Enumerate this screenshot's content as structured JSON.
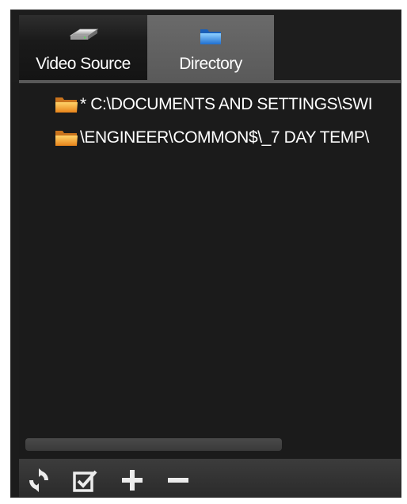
{
  "tabs": [
    {
      "label": "Video Source",
      "icon": "drive-icon",
      "selected": false
    },
    {
      "label": "Directory",
      "icon": "folder-icon",
      "selected": true
    }
  ],
  "tree": {
    "items": [
      {
        "label": "* C:\\DOCUMENTS AND SETTINGS\\SWI",
        "icon": "folder-icon"
      },
      {
        "label": "\\ENGINEER\\COMMON$\\_7 DAY TEMP\\",
        "icon": "folder-icon"
      }
    ]
  },
  "toolbar": {
    "buttons": [
      {
        "name": "refresh",
        "icon": "refresh-icon"
      },
      {
        "name": "select",
        "icon": "checkbox-edit-icon"
      },
      {
        "name": "add",
        "icon": "plus-icon"
      },
      {
        "name": "remove",
        "icon": "minus-icon"
      }
    ]
  },
  "colors": {
    "panel_bg": "#1b1b1b",
    "tab_selected": "#5e5e5e",
    "folder": "#f0a030",
    "text": "#ffffff"
  }
}
